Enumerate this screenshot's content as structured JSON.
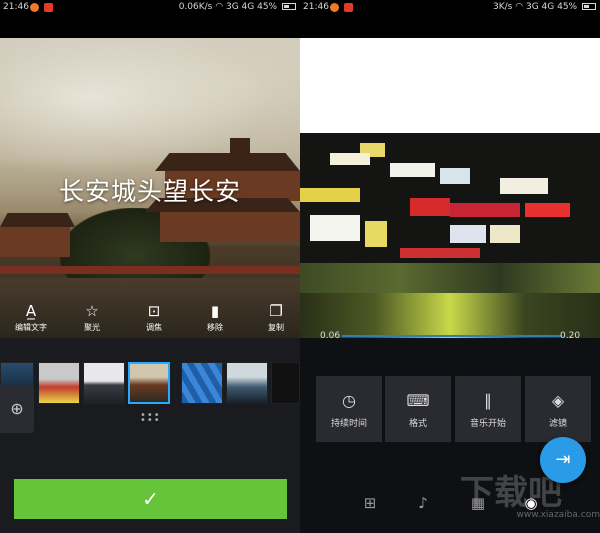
{
  "left": {
    "status": {
      "time": "21:46",
      "net_speed": "0.06K/s",
      "network": "3G 4G",
      "battery": "45%"
    },
    "overlay_text": "长安城头望长安",
    "tools": [
      {
        "icon": "text-icon",
        "label": "编辑文字"
      },
      {
        "icon": "star-icon",
        "label": "聚光"
      },
      {
        "icon": "focus-icon",
        "label": "调焦"
      },
      {
        "icon": "trash-icon",
        "label": "移除"
      },
      {
        "icon": "copy-icon",
        "label": "复制"
      }
    ],
    "confirm_icon": "✓"
  },
  "right": {
    "status": {
      "time": "21:46",
      "net_speed": "3K/s",
      "network": "3G 4G",
      "battery": "45%"
    },
    "timeline": {
      "start": "0.06",
      "end": "0.20",
      "progress": 1.0
    },
    "cards": [
      {
        "icon": "clock-icon",
        "label": "持续时间"
      },
      {
        "icon": "keyboard-icon",
        "label": "格式"
      },
      {
        "icon": "audio-wave-icon",
        "label": "音乐开始"
      },
      {
        "icon": "eraser-icon",
        "label": "滤镜"
      }
    ],
    "watermark": "下载吧",
    "watermark_url": "www.xiazaiba.com"
  }
}
